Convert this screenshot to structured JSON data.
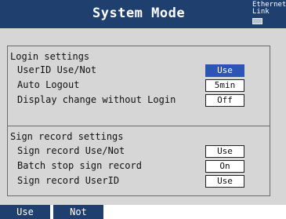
{
  "header": {
    "title": "System Mode",
    "status_line1": "Ethernet",
    "status_line2": "Link"
  },
  "login_settings": {
    "title": "Login settings",
    "rows": [
      {
        "label": "UserID Use/Not",
        "value": "Use",
        "selected": true
      },
      {
        "label": "Auto Logout",
        "value": "5min",
        "selected": false
      },
      {
        "label": "Display change without Login",
        "value": "Off",
        "selected": false
      }
    ]
  },
  "sign_record_settings": {
    "title": "Sign record settings",
    "rows": [
      {
        "label": "Sign record Use/Not",
        "value": "Use"
      },
      {
        "label": "Batch stop sign record",
        "value": "On"
      },
      {
        "label": "Sign record UserID",
        "value": "Use"
      }
    ]
  },
  "softkeys": {
    "use": "Use",
    "not": "Not"
  },
  "colors": {
    "header_bg": "#1f3f6f",
    "panel_bg": "#d6d6d6",
    "selected_bg": "#2d55b5"
  }
}
